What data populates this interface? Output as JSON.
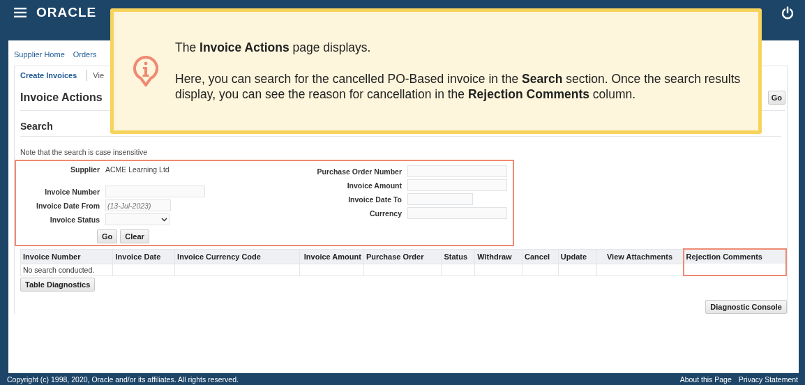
{
  "header": {
    "logo": "ORACLE"
  },
  "nav_links": [
    {
      "label": "Supplier Home"
    },
    {
      "label": "Orders"
    }
  ],
  "subtabs": [
    {
      "label": "Create Invoices",
      "selected": true
    },
    {
      "label": "Vie",
      "selected": false
    }
  ],
  "page_title": "Invoice Actions",
  "title_button": "Go",
  "section_title": "Search",
  "note": "Note that the search is case insensitive",
  "search_form": {
    "highlighted": true,
    "left_fields": [
      {
        "label": "Supplier",
        "kind": "text",
        "value": "ACME Learning Ltd"
      },
      {
        "label": "Invoice Number",
        "kind": "input"
      },
      {
        "label": "Invoice Date From",
        "kind": "date",
        "placeholder": "(13-Jul-2023)"
      },
      {
        "label": "Invoice Status",
        "kind": "select"
      }
    ],
    "right_fields": [
      {
        "label": "Purchase Order Number",
        "kind": "input"
      },
      {
        "label": "Invoice Amount",
        "kind": "input"
      },
      {
        "label": "Invoice Date To",
        "kind": "date"
      },
      {
        "label": "Currency",
        "kind": "input"
      }
    ],
    "buttons": [
      "Go",
      "Clear"
    ]
  },
  "table": {
    "columns": [
      {
        "label": "Invoice Number",
        "highlighted": false
      },
      {
        "label": "Invoice Date",
        "highlighted": false
      },
      {
        "label": "Invoice Currency Code",
        "highlighted": false
      },
      {
        "label": "Invoice Amount",
        "highlighted": false
      },
      {
        "label": "Purchase Order",
        "highlighted": false
      },
      {
        "label": "Status",
        "highlighted": false
      },
      {
        "label": "Withdraw",
        "highlighted": false
      },
      {
        "label": "Cancel",
        "highlighted": false
      },
      {
        "label": "Update",
        "highlighted": false
      },
      {
        "label": "View Attachments",
        "highlighted": false
      },
      {
        "label": "Rejection Comments",
        "highlighted": true
      }
    ],
    "empty_message": "No search conducted."
  },
  "table_button": "Table Diagnostics",
  "console_button": "Diagnostic Console",
  "footer": {
    "copyright": "Copyright (c) 1998, 2020, Oracle and/or its affiliates. All rights reserved.",
    "links": [
      "About this Page",
      "Privacy Statement"
    ]
  },
  "callout": {
    "paragraphs": [
      "The **Invoice Actions** page displays.",
      "Here, you can search for the cancelled PO-Based invoice in the **Search** section. Once the search results display, you can see the reason for cancellation in the **Rejection Comments** column."
    ]
  }
}
